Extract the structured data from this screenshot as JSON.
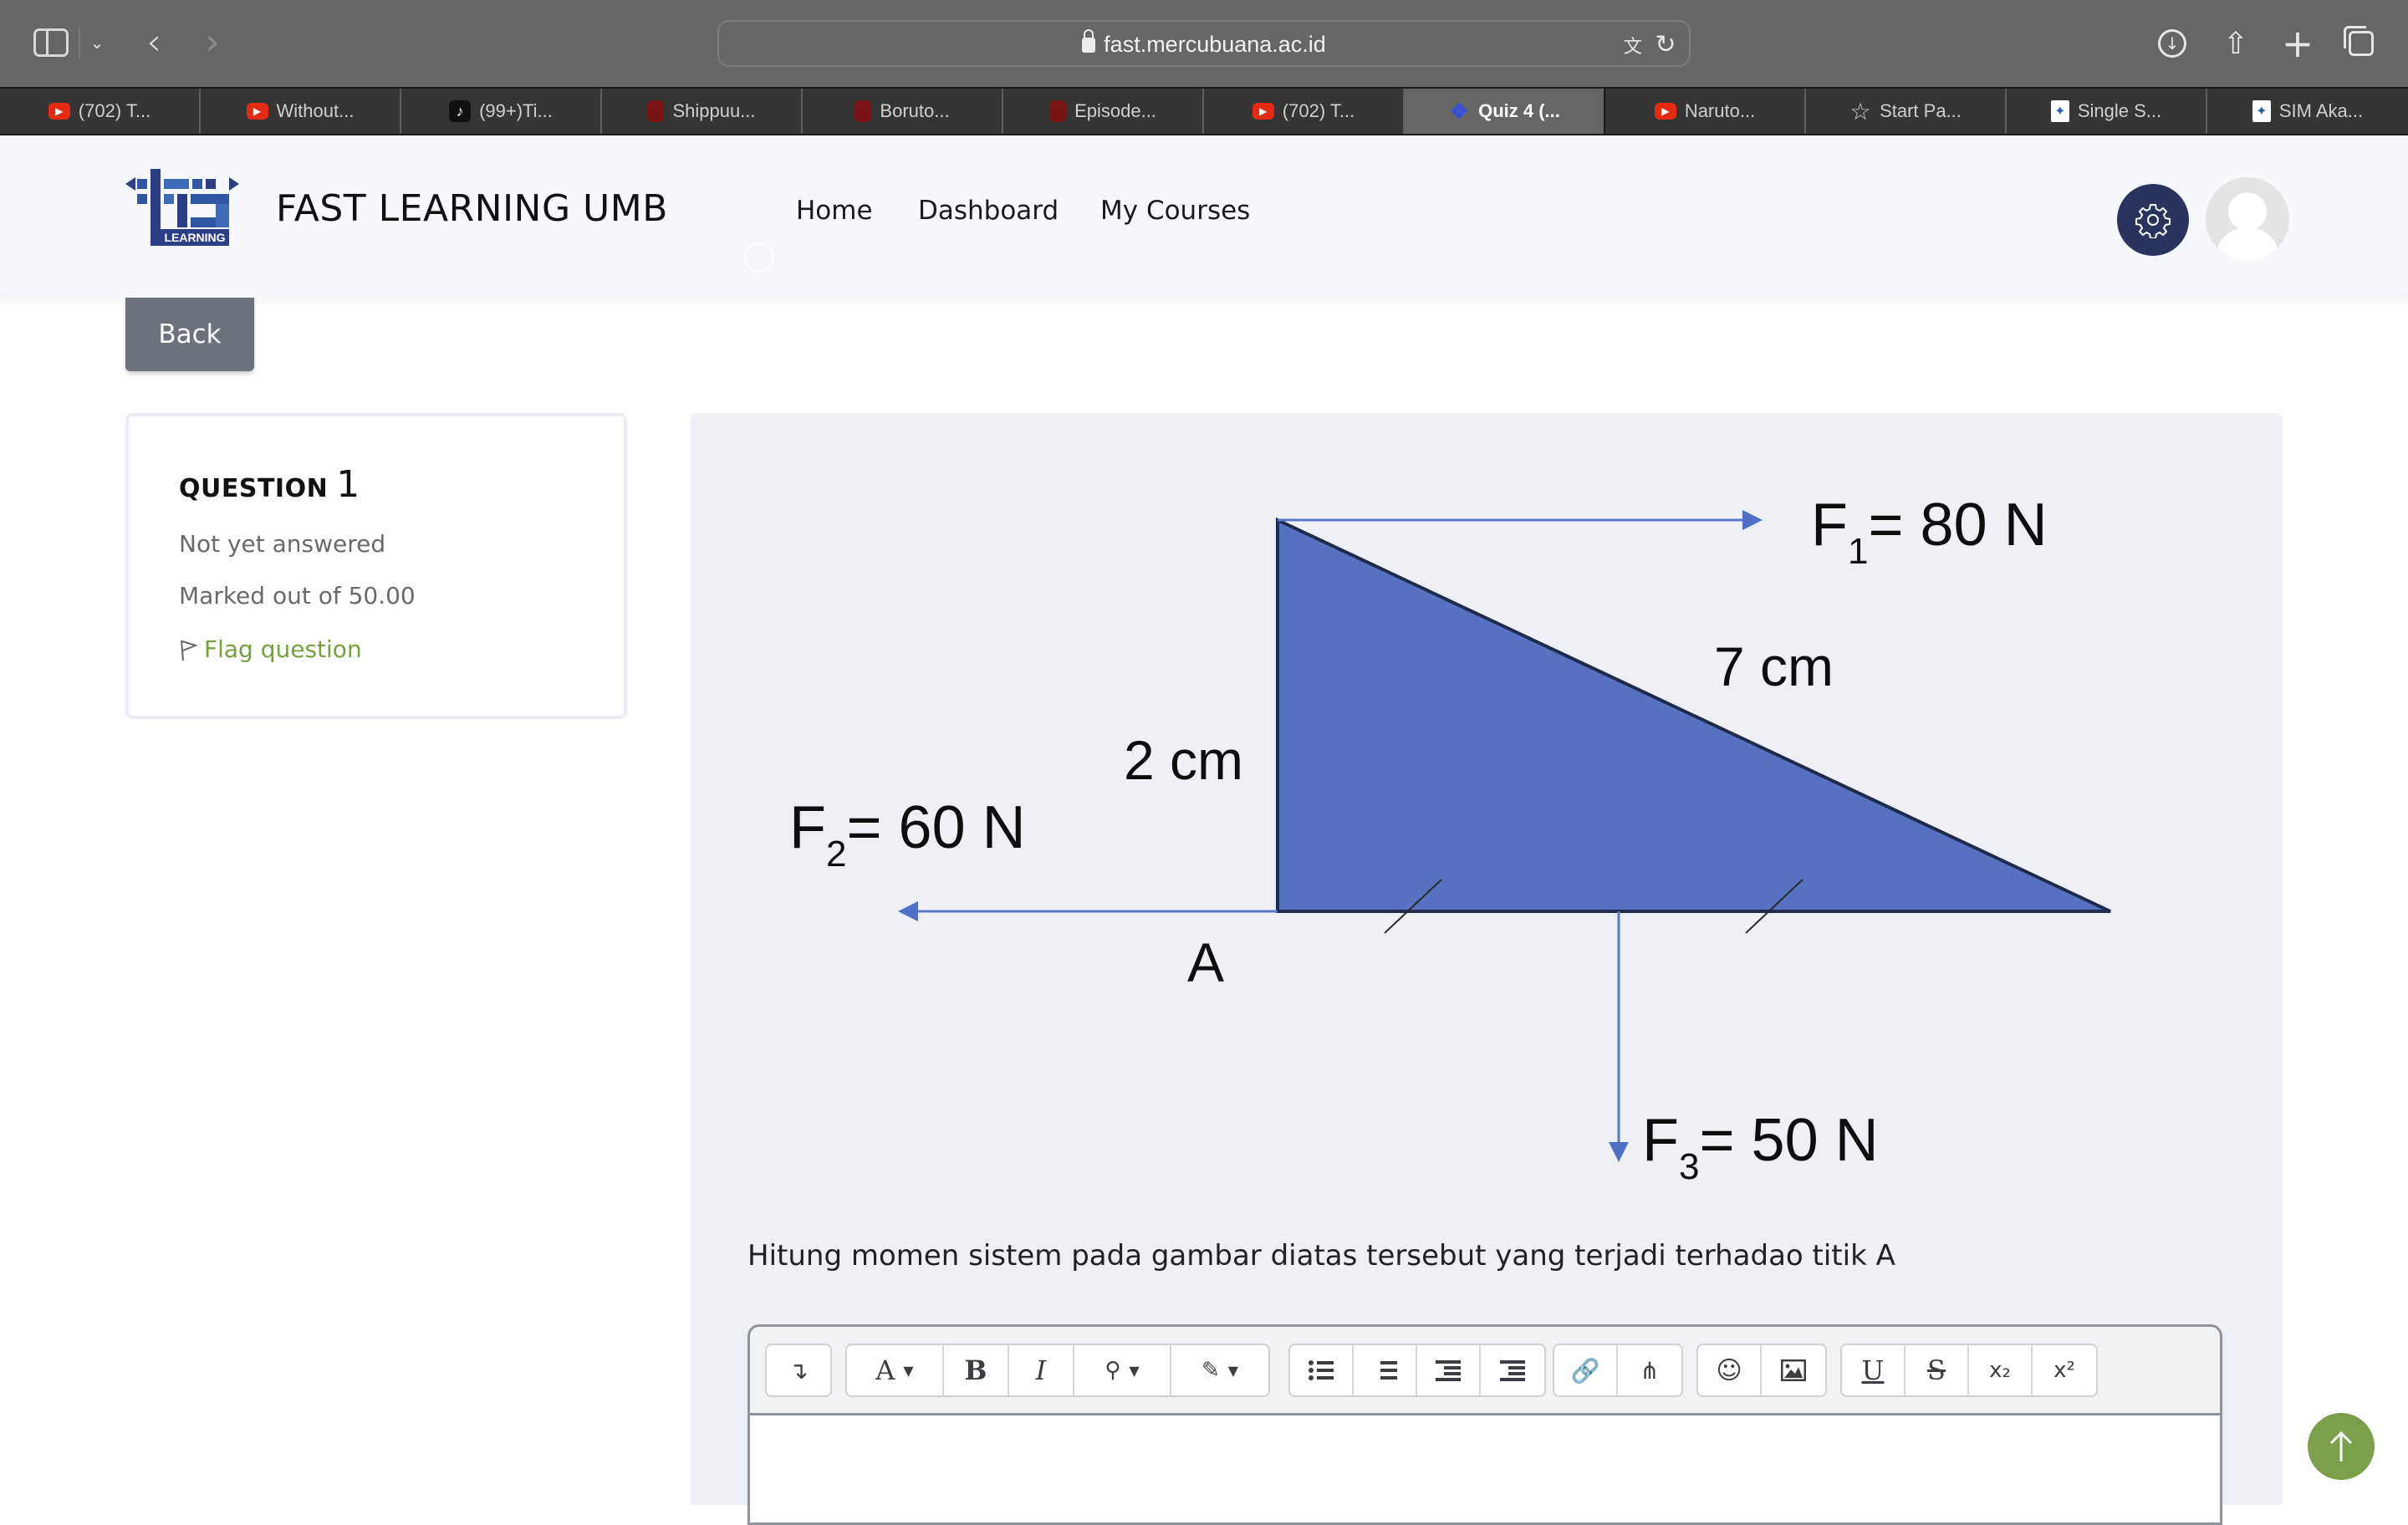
{
  "browser": {
    "url": "fast.mercubuana.ac.id",
    "tabs": [
      {
        "label": "(702) T...",
        "favicon": "youtube-icon",
        "active": false
      },
      {
        "label": "Without...",
        "favicon": "youtube-icon",
        "active": false
      },
      {
        "label": "(99+)Ti...",
        "favicon": "tiktok-icon",
        "active": false
      },
      {
        "label": "Shippuu...",
        "favicon": "manga-icon",
        "active": false
      },
      {
        "label": "Boruto...",
        "favicon": "manga-icon",
        "active": false
      },
      {
        "label": "Episode...",
        "favicon": "manga-icon",
        "active": false
      },
      {
        "label": "(702) T...",
        "favicon": "youtube-icon",
        "active": false
      },
      {
        "label": "Quiz 4 (...",
        "favicon": "quiz-icon",
        "active": true
      },
      {
        "label": "Naruto...",
        "favicon": "youtube-icon",
        "active": false
      },
      {
        "label": "Start Pa...",
        "favicon": "star-icon",
        "active": false
      },
      {
        "label": "Single S...",
        "favicon": "umb-icon",
        "active": false
      },
      {
        "label": "SIM Aka...",
        "favicon": "umb-icon",
        "active": false
      }
    ]
  },
  "header": {
    "brand": "FAST LEARNING UMB",
    "logo_caption": "LEARNING",
    "nav": [
      "Home",
      "Dashboard",
      "My Courses"
    ]
  },
  "back_label": "Back",
  "question_info": {
    "label": "QUESTION",
    "number": "1",
    "state": "Not yet answered",
    "marks": "Marked out of 50.00",
    "flag_label": "Flag question"
  },
  "diagram": {
    "f1": {
      "name": "F",
      "sub": "1",
      "value": "= 80 N"
    },
    "f2": {
      "name": "F",
      "sub": "2",
      "value": "= 60 N"
    },
    "f3": {
      "name": "F",
      "sub": "3",
      "value": "= 50 N"
    },
    "side_hyp": "7 cm",
    "side_vertical": "2 cm",
    "point": "A",
    "fill_color": "#5571c0",
    "arrow_color": "#5b78c8"
  },
  "question_text": "Hitung momen sistem pada gambar diatas tersebut yang terjadi terhadao titik A",
  "editor": {
    "toolbar_groups": [
      [
        "toggle-more"
      ],
      [
        "font-color",
        "bold",
        "italic",
        "highlight",
        "paint"
      ],
      [
        "bullet-list",
        "numbered-list",
        "outdent",
        "indent"
      ],
      [
        "link",
        "unlink"
      ],
      [
        "emoji",
        "image"
      ],
      [
        "underline",
        "strikethrough",
        "subscript",
        "superscript"
      ]
    ],
    "glyphs": {
      "bold": "B",
      "italic": "I",
      "font": "A",
      "underline": "U",
      "strike": "S",
      "sub": "x₂",
      "sup": "x²"
    },
    "content": ""
  }
}
